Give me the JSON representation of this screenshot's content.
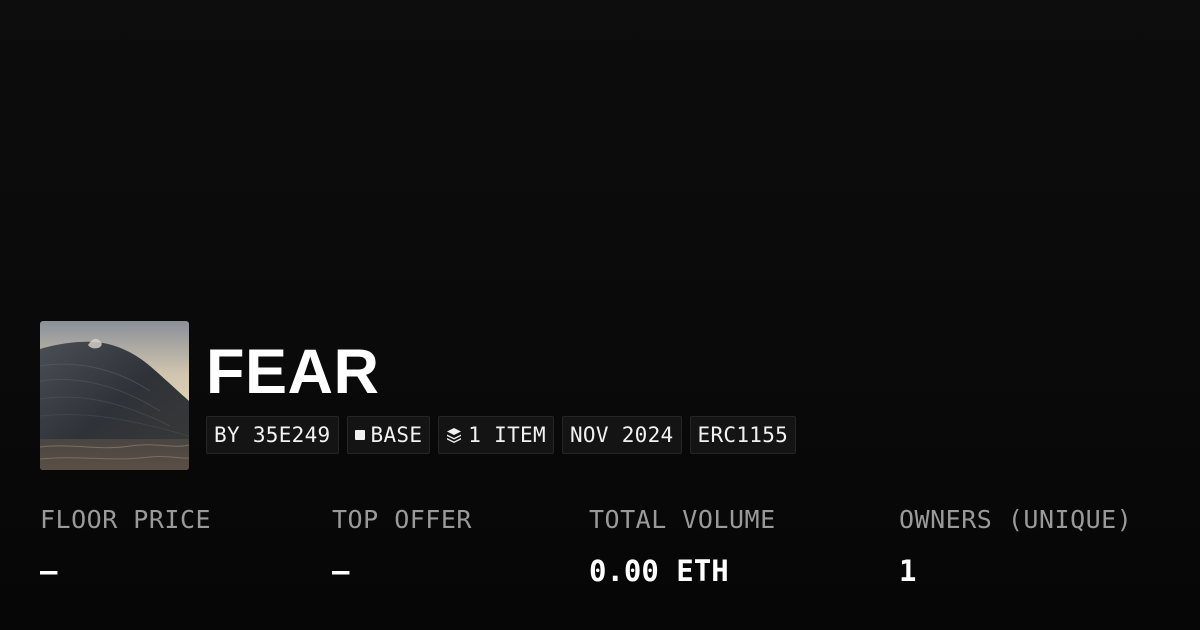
{
  "collection": {
    "title": "FEAR",
    "badges": {
      "creator": "BY 35E249",
      "chain": "BASE",
      "items": "1 ITEM",
      "date": "NOV 2024",
      "standard": "ERC1155"
    }
  },
  "stats": [
    {
      "label": "FLOOR PRICE",
      "value": "—"
    },
    {
      "label": "TOP OFFER",
      "value": "—"
    },
    {
      "label": "TOTAL VOLUME",
      "value": "0.00 ETH"
    },
    {
      "label": "OWNERS (UNIQUE)",
      "value": "1"
    }
  ],
  "icons": {
    "chain": "square-icon",
    "items": "layers-icon"
  },
  "colors": {
    "background": "#0a0a0a",
    "badge_bg": "#141414",
    "label": "#9a9a9a",
    "text": "#ffffff"
  }
}
